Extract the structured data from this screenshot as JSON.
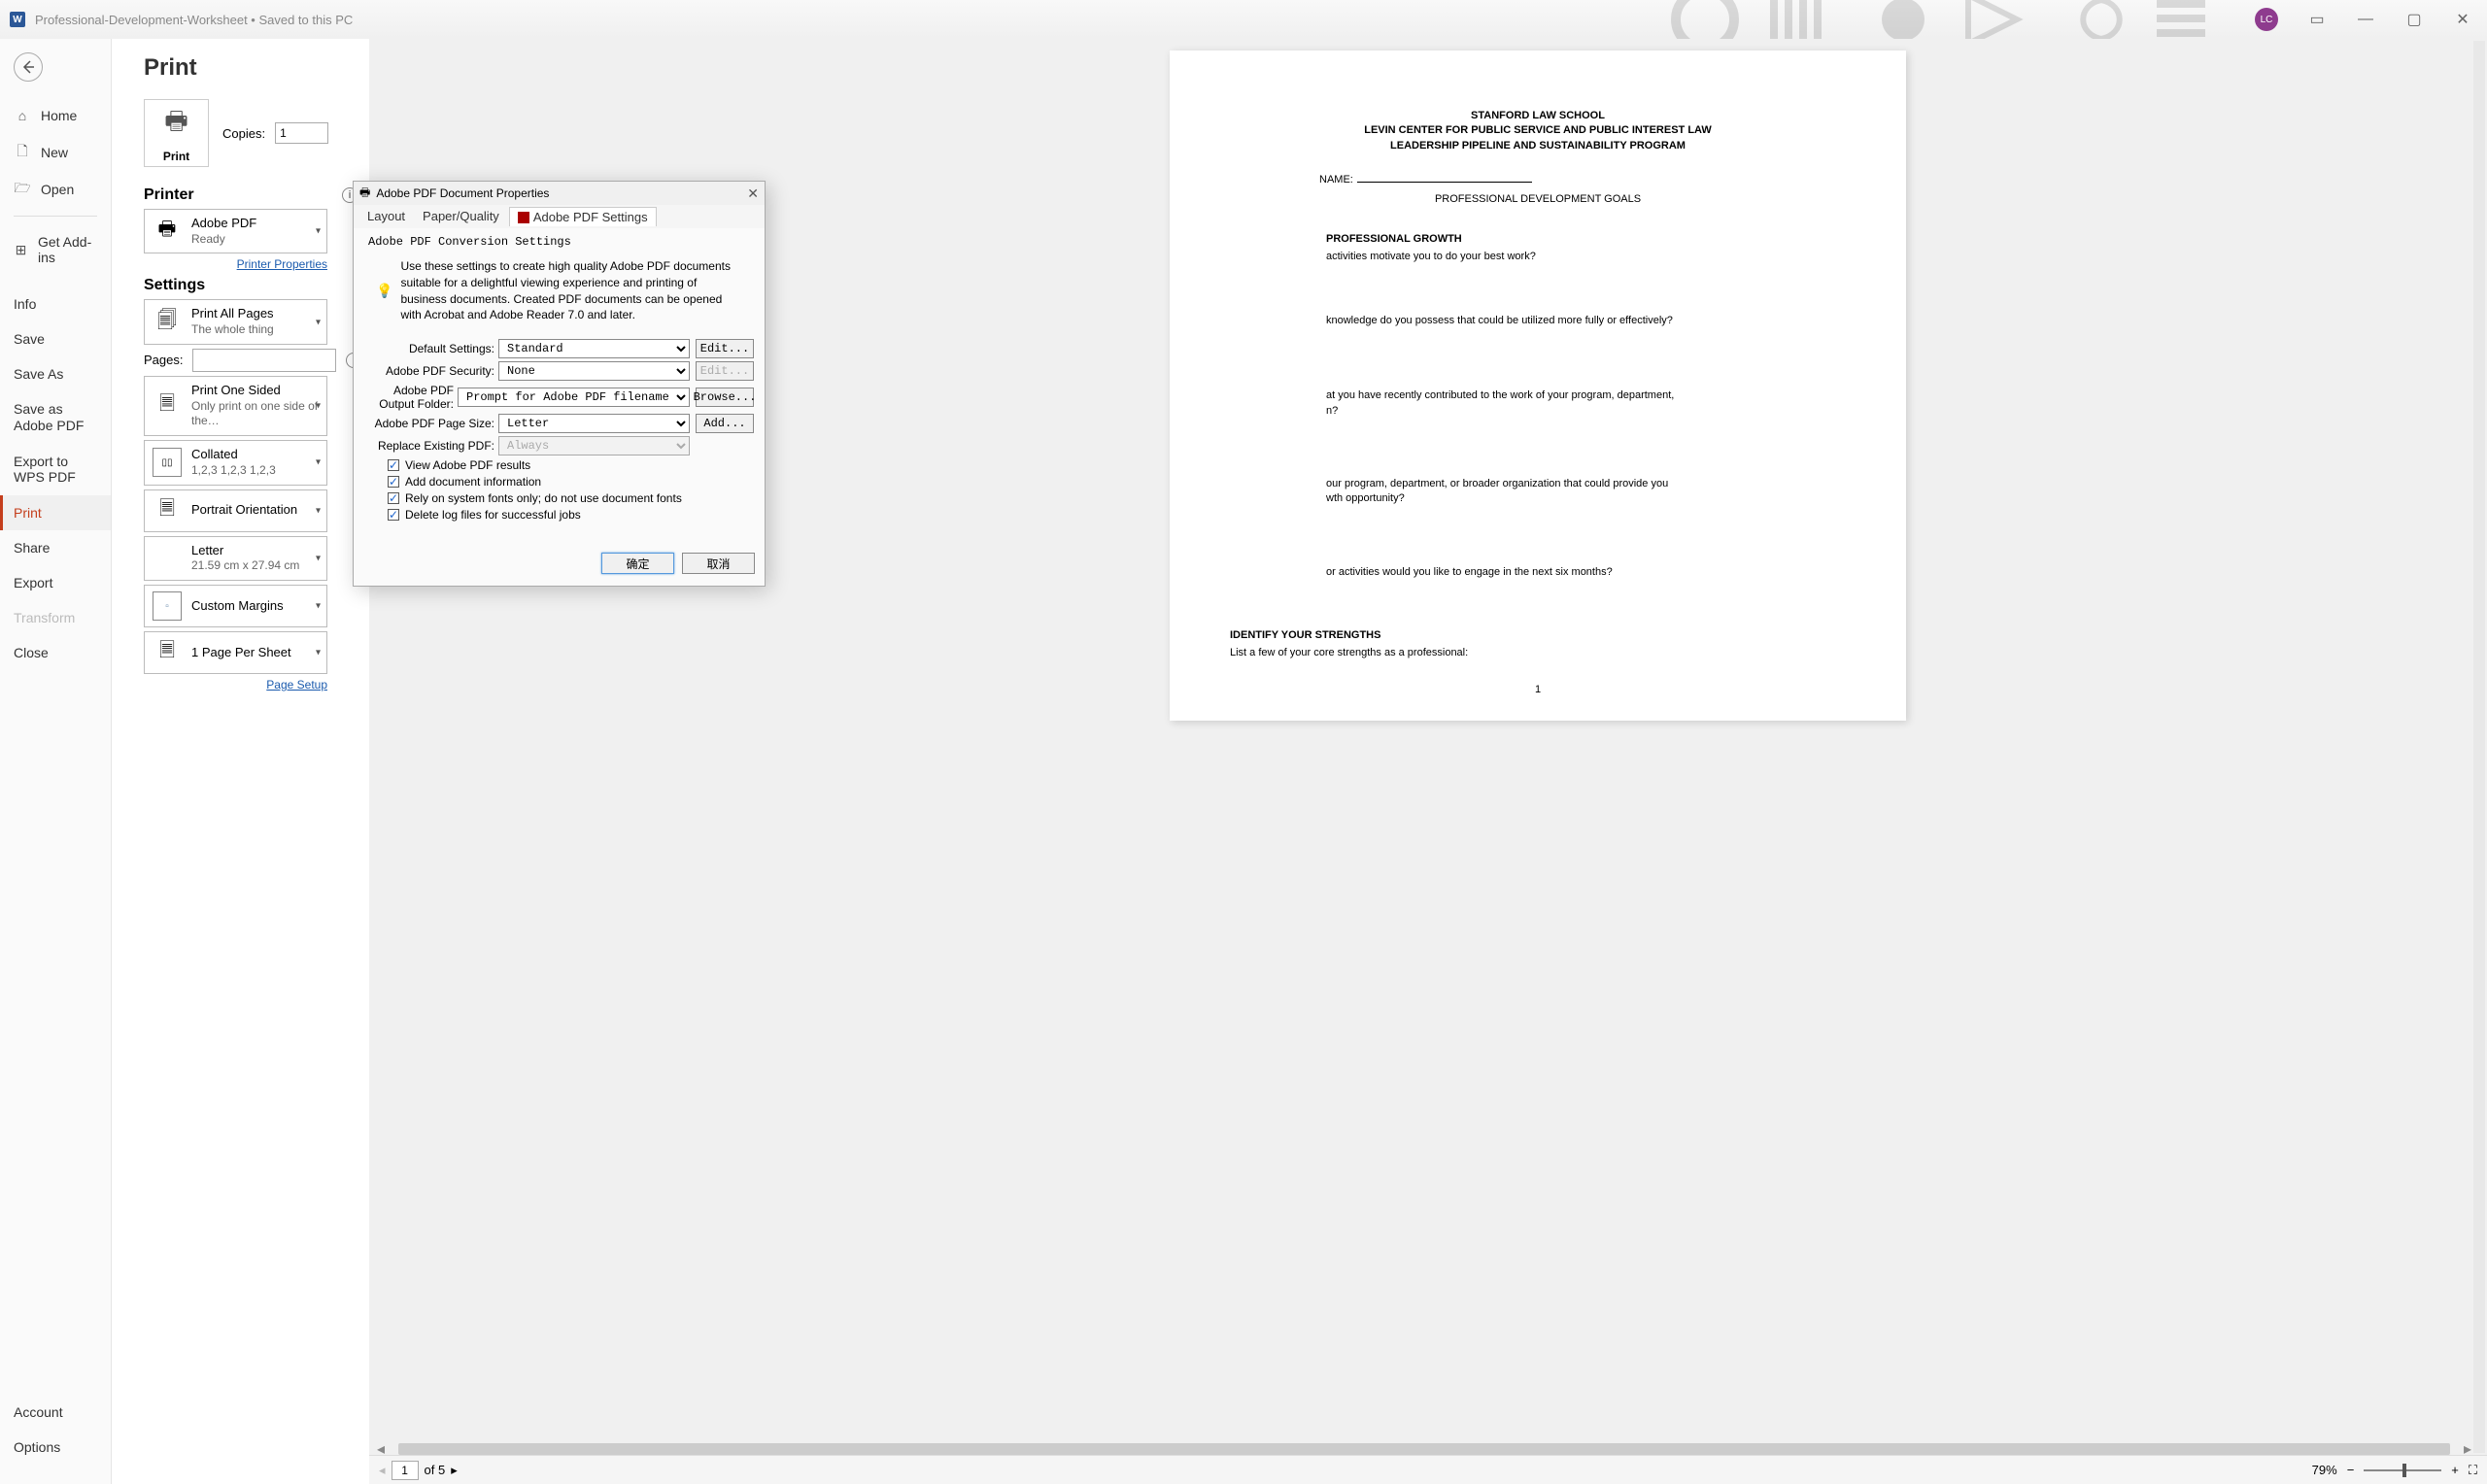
{
  "titlebar": {
    "doc_name": "Professional-Development-Worksheet • Saved to this PC",
    "word_label": "W",
    "avatar_initials": "LC"
  },
  "nav": {
    "home": "Home",
    "new": "New",
    "open": "Open",
    "addins": "Get Add-ins",
    "info": "Info",
    "save": "Save",
    "saveas": "Save As",
    "save_adobe": "Save as Adobe PDF",
    "export_wps": "Export to WPS PDF",
    "print": "Print",
    "share": "Share",
    "export": "Export",
    "transform": "Transform",
    "close": "Close",
    "account": "Account",
    "options": "Options"
  },
  "print": {
    "title": "Print",
    "btn": "Print",
    "copies_label": "Copies:",
    "copies_value": "1",
    "printer_header": "Printer",
    "printer_name": "Adobe PDF",
    "printer_status": "Ready",
    "printer_props": "Printer Properties",
    "settings_header": "Settings",
    "s1_main": "Print All Pages",
    "s1_sub": "The whole thing",
    "pages_label": "Pages:",
    "s2_main": "Print One Sided",
    "s2_sub": "Only print on one side of the…",
    "s3_main": "Collated",
    "s3_sub": "1,2,3    1,2,3    1,2,3",
    "s4_main": "Portrait Orientation",
    "s5_main": "Letter",
    "s5_sub": "21.59 cm x 27.94 cm",
    "s6_main": "Custom Margins",
    "s7_main": "1 Page Per Sheet",
    "page_setup": "Page Setup"
  },
  "preview_nav": {
    "current": "1",
    "of": "of 5",
    "zoom": "79%"
  },
  "document": {
    "h1": "STANFORD LAW SCHOOL",
    "h2": "LEVIN CENTER FOR PUBLIC SERVICE AND PUBLIC INTEREST LAW",
    "h3": "LEADERSHIP PIPELINE AND SUSTAINABILITY PROGRAM",
    "name_label": "NAME:",
    "subtitle": "PROFESSIONAL DEVELOPMENT GOALS",
    "sec1_title": "PROFESSIONAL GROWTH",
    "sec1_q1": "activities motivate you to do your best work?",
    "sec1_q2": "knowledge do you possess that could be utilized more fully or effectively?",
    "sec1_q3a": "at you have recently contributed to the work of your program, department,",
    "sec1_q3b": "n?",
    "sec1_q4a": "our program, department, or broader organization that could provide you",
    "sec1_q4b": "wth opportunity?",
    "sec1_q5": "or activities would you like to engage in the next six months?",
    "sec2_title": "IDENTIFY YOUR STRENGTHS",
    "sec2_q1": "List a few of your core strengths as a professional:",
    "page_num": "1"
  },
  "dialog": {
    "title": "Adobe PDF Document Properties",
    "tab_layout": "Layout",
    "tab_paper": "Paper/Quality",
    "tab_pdf": "Adobe PDF Settings",
    "group_legend": "Adobe PDF Conversion Settings",
    "description": "Use these settings to create high quality Adobe PDF documents suitable for a delightful viewing experience and printing of business documents. Created PDF documents can be opened with Acrobat and Adobe Reader 7.0 and later.",
    "default_label": "Default Settings:",
    "default_value": "Standard",
    "security_label": "Adobe PDF Security:",
    "security_value": "None",
    "output_label": "Adobe PDF Output Folder:",
    "output_value": "Prompt for Adobe PDF filename",
    "pagesize_label": "Adobe PDF Page Size:",
    "pagesize_value": "Letter",
    "replace_label": "Replace Existing PDF:",
    "replace_value": "Always",
    "edit_btn": "Edit...",
    "browse_btn": "Browse...",
    "add_btn": "Add...",
    "chk1": "View Adobe PDF results",
    "chk2": "Add document information",
    "chk3": "Rely on system fonts only; do not use document fonts",
    "chk4": "Delete log files for successful jobs",
    "ok_btn": "确定",
    "cancel_btn": "取消"
  }
}
